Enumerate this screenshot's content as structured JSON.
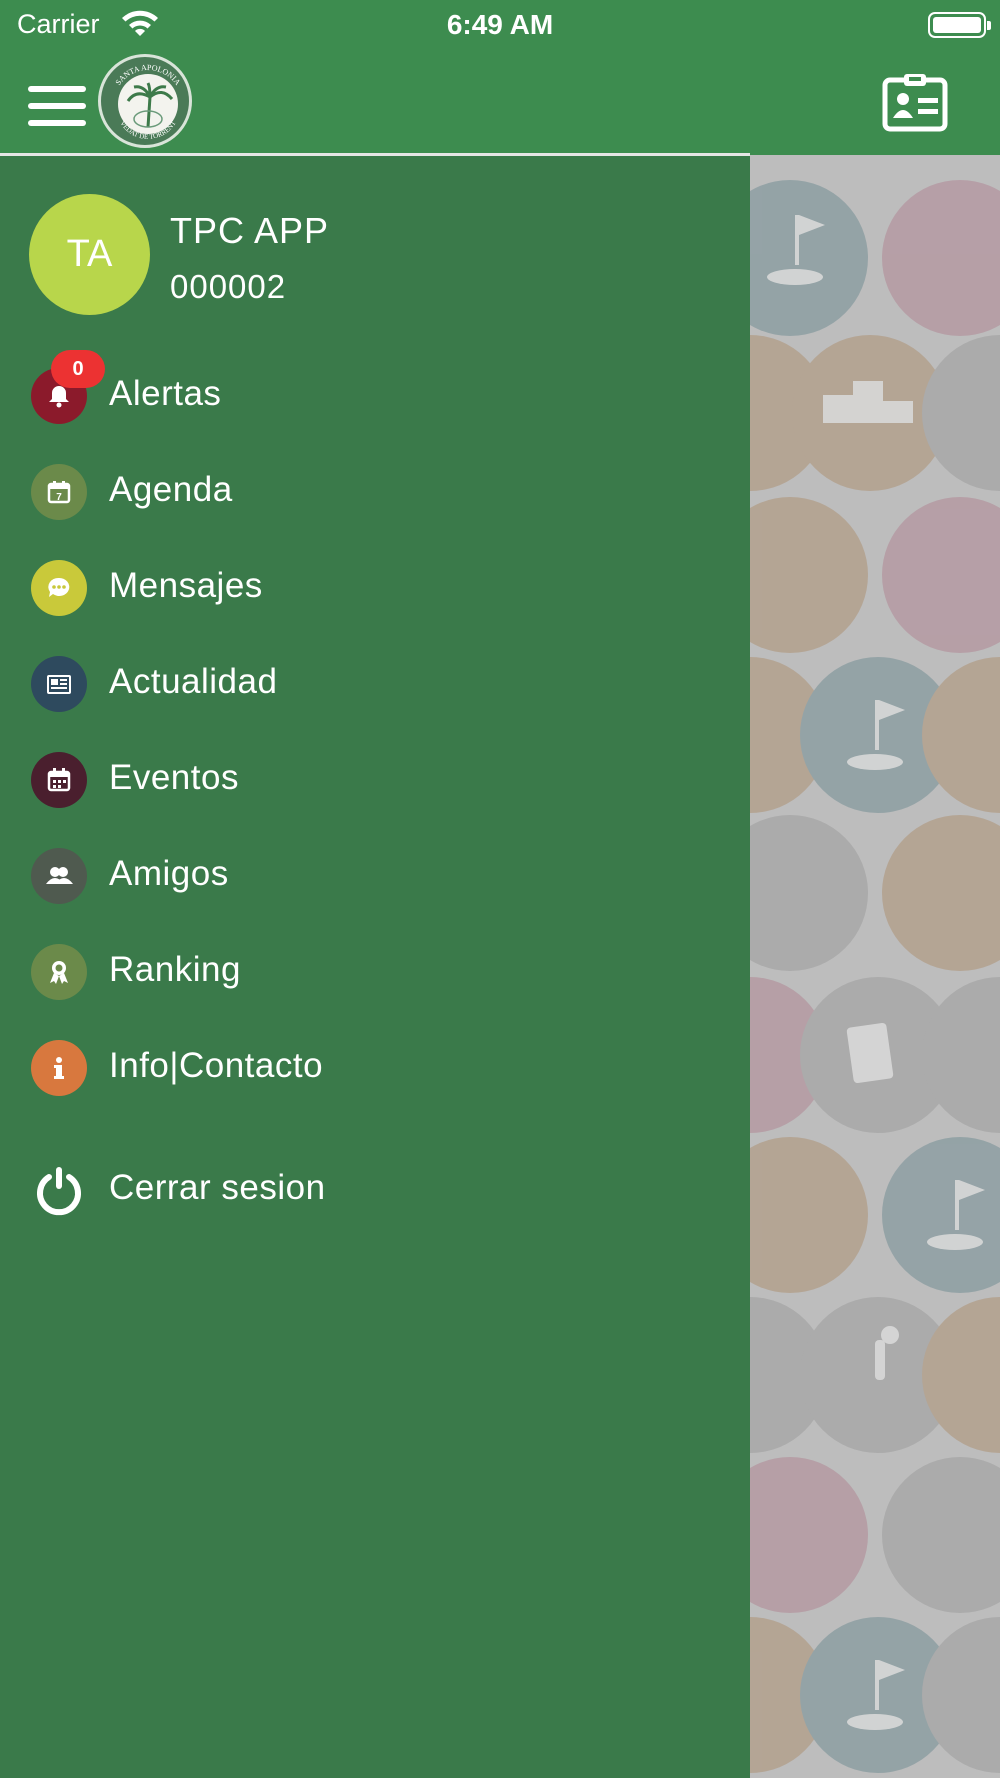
{
  "status_bar": {
    "carrier": "Carrier",
    "time": "6:49 AM"
  },
  "header": {
    "logo_top_text": "SANTA APOLONIA",
    "logo_bottom_text": "VEDAT DE TORRENT"
  },
  "user": {
    "initials": "TA",
    "name": "TPC APP",
    "id": "000002"
  },
  "menu": [
    {
      "label": "Alertas",
      "icon": "bell-icon",
      "color": "#8b1a2b",
      "badge": "0"
    },
    {
      "label": "Agenda",
      "icon": "calendar-day-icon",
      "color": "#6b8a4a"
    },
    {
      "label": "Mensajes",
      "icon": "chat-icon",
      "color": "#c9c93a"
    },
    {
      "label": "Actualidad",
      "icon": "newspaper-icon",
      "color": "#2e4a5e"
    },
    {
      "label": "Eventos",
      "icon": "calendar-grid-icon",
      "color": "#4a1f2e"
    },
    {
      "label": "Amigos",
      "icon": "friends-icon",
      "color": "#4f5a4f"
    },
    {
      "label": "Ranking",
      "icon": "award-ribbon-icon",
      "color": "#6b8a4a"
    },
    {
      "label": "Info|Contacto",
      "icon": "info-icon",
      "color": "#d8783e"
    },
    {
      "label": "Cerrar sesion",
      "icon": "power-icon",
      "color": "transparent"
    }
  ],
  "colors": {
    "header_green": "#3d8c4f",
    "drawer_green": "#3a7a4a",
    "avatar_lime": "#b8d64b",
    "badge_red": "#ec3232"
  }
}
